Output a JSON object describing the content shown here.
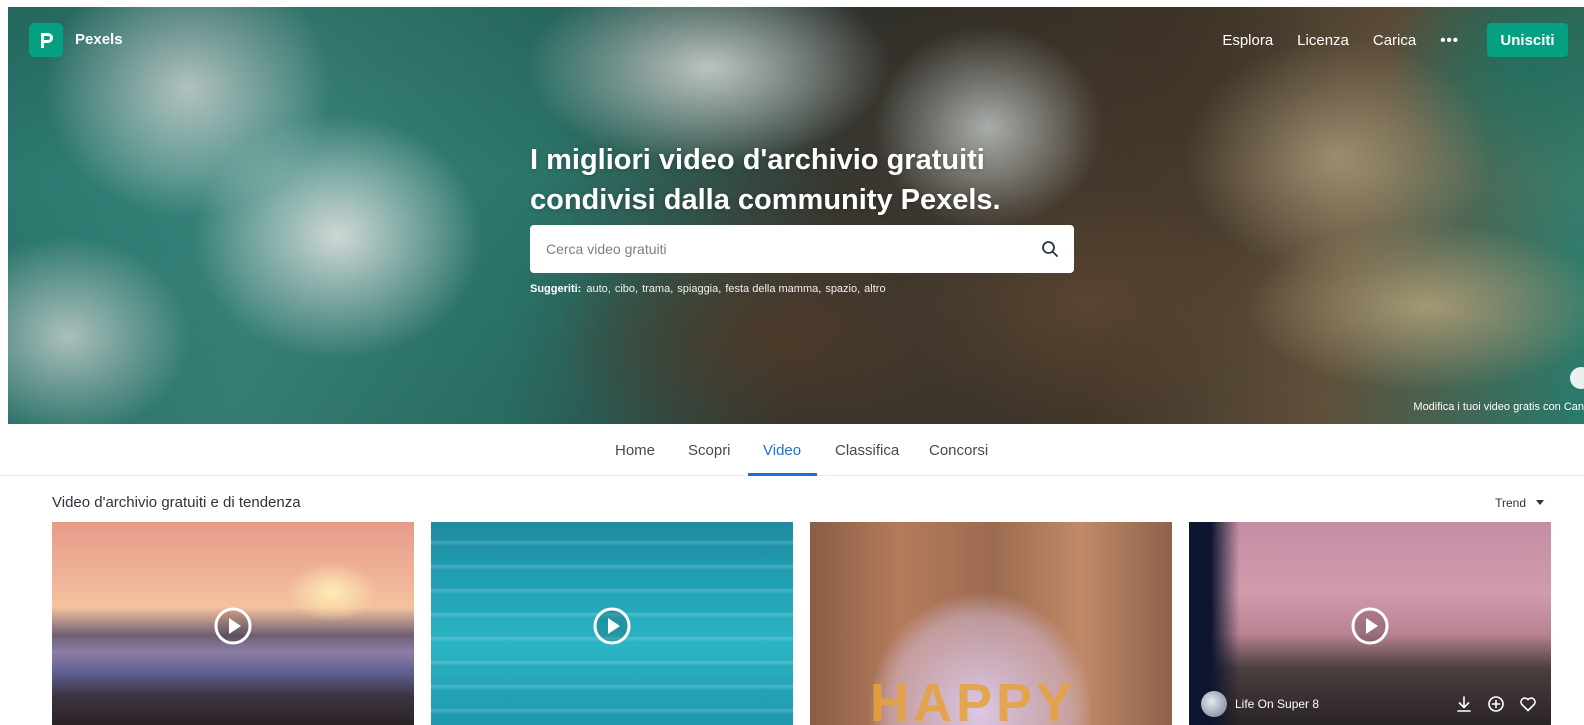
{
  "header": {
    "brand": "Pexels",
    "nav": [
      "Esplora",
      "Licenza",
      "Carica"
    ],
    "more": "•••",
    "join_label": "Unisciti"
  },
  "hero": {
    "title": "I migliori video d'archivio gratuiti condivisi dalla community Pexels.",
    "search_placeholder": "Cerca video gratuiti",
    "suggestions_label": "Suggeriti:",
    "suggestions": [
      "auto",
      "cibo",
      "trama",
      "spiaggia",
      "festa della mamma",
      "spazio",
      "altro"
    ],
    "canva_caption": "Modifica i tuoi video gratis con Can"
  },
  "tabs": [
    {
      "label": "Home",
      "active": false
    },
    {
      "label": "Scopri",
      "active": false
    },
    {
      "label": "Video",
      "active": true
    },
    {
      "label": "Classifica",
      "active": false
    },
    {
      "label": "Concorsi",
      "active": false
    }
  ],
  "section": {
    "title": "Video d'archivio gratuiti e di tendenza",
    "sort_label": "Trend"
  },
  "cards": [
    {
      "theme": "sunset-lake",
      "has_play": true
    },
    {
      "theme": "swimming-pool",
      "has_play": true
    },
    {
      "theme": "happy-balloon",
      "has_play": false,
      "overlay_text": "HAPPY"
    },
    {
      "theme": "dusk-field",
      "has_play": true,
      "author": "Life On Super 8",
      "actions": [
        "download-icon",
        "add-collection-icon",
        "like-icon"
      ]
    }
  ],
  "colors": {
    "brand_green": "#05a081",
    "tab_active": "#1f70d4",
    "text_dark": "#2c343e"
  }
}
